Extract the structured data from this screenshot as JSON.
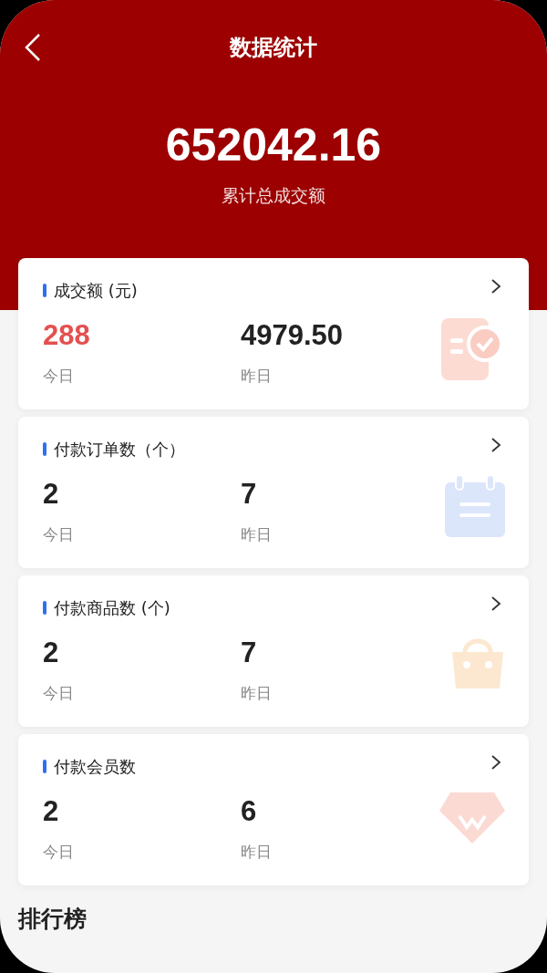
{
  "header": {
    "title": "数据统计",
    "total": "652042.16",
    "total_label": "累计总成交额"
  },
  "cards": [
    {
      "title": "成交额 (元)",
      "kind": "receipt",
      "today": {
        "value": "288",
        "label": "今日",
        "highlight": true
      },
      "yesterday": {
        "value": "4979.50",
        "label": "昨日"
      }
    },
    {
      "title": "付款订单数（个）",
      "kind": "calendar",
      "today": {
        "value": "2",
        "label": "今日",
        "highlight": false
      },
      "yesterday": {
        "value": "7",
        "label": "昨日"
      }
    },
    {
      "title": "付款商品数 (个)",
      "kind": "bag",
      "today": {
        "value": "2",
        "label": "今日",
        "highlight": false
      },
      "yesterday": {
        "value": "7",
        "label": "昨日"
      }
    },
    {
      "title": "付款会员数",
      "kind": "gem",
      "today": {
        "value": "2",
        "label": "今日",
        "highlight": false
      },
      "yesterday": {
        "value": "6",
        "label": "昨日"
      }
    }
  ],
  "section_title": "排行榜"
}
